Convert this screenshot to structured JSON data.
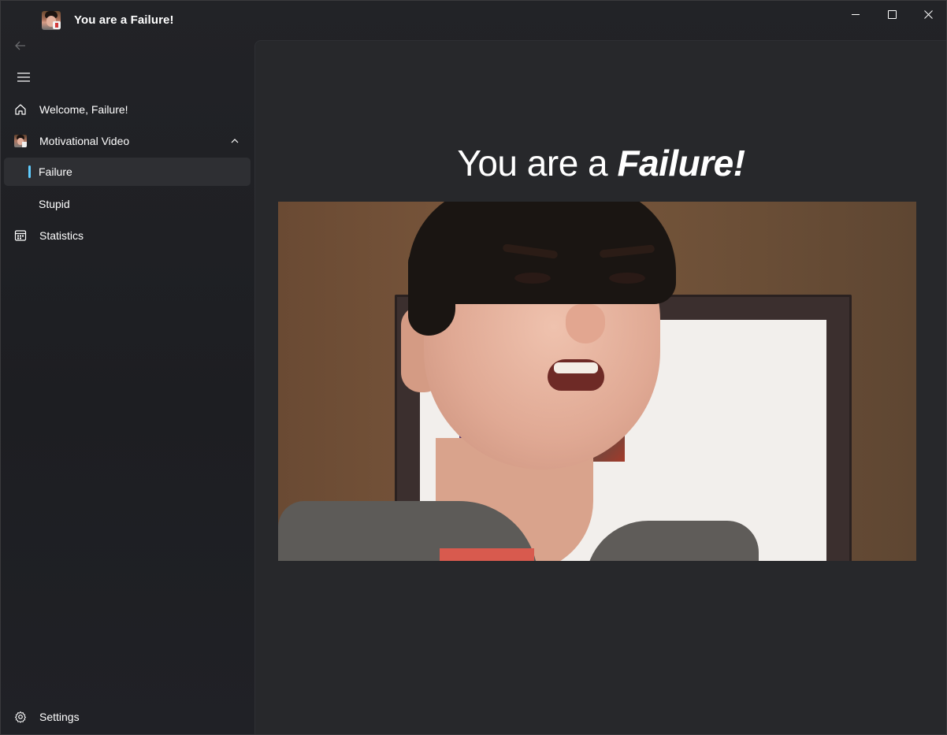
{
  "window": {
    "title": "You are a Failure!",
    "controls": [
      "minimize",
      "maximize",
      "close"
    ]
  },
  "sidebar": {
    "back_icon": "arrow-left-icon",
    "menu_icon": "hamburger-menu-icon",
    "items": [
      {
        "label": "Welcome, Failure!",
        "icon": "home-icon"
      },
      {
        "label": "Motivational Video",
        "icon": "app-thumbnail-icon",
        "expanded": true,
        "children": [
          {
            "label": "Failure",
            "selected": true
          },
          {
            "label": "Stupid",
            "selected": false
          }
        ]
      },
      {
        "label": "Statistics",
        "icon": "calendar-grid-icon"
      }
    ],
    "footer": {
      "label": "Settings",
      "icon": "gear-icon"
    }
  },
  "main": {
    "headline_prefix": "You are a ",
    "headline_emphasis": "Failure!"
  },
  "colors": {
    "accent": "#60cdff",
    "background": "#1f2023",
    "content_background": "#27282b",
    "selected_item": "#2e2f33"
  }
}
